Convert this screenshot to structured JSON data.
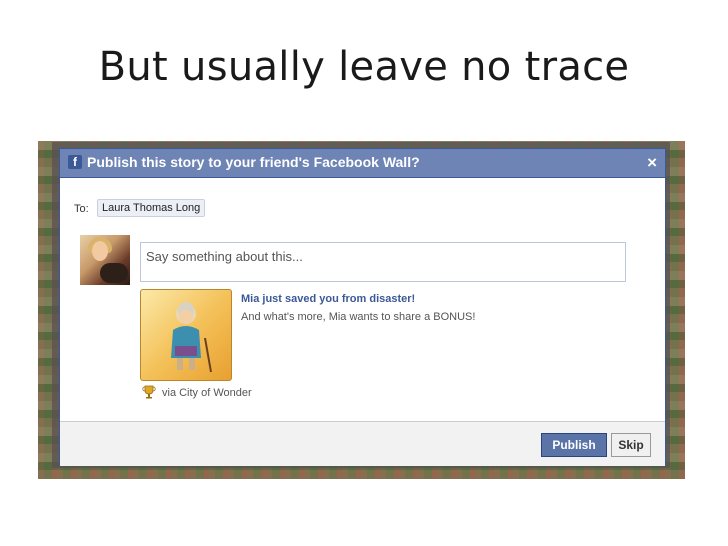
{
  "slide": {
    "title": "But usually leave no trace"
  },
  "dialog": {
    "title": "Publish this story to your friend's Facebook Wall?",
    "logo_letter": "f",
    "close_glyph": "×",
    "to_label": "To:",
    "recipient": "Laura Thomas Long",
    "comment_placeholder": "Say something about this...",
    "story": {
      "title": "Mia just saved you from disaster!",
      "description": "And what's more, Mia wants to share a BONUS!",
      "via": "via City of Wonder",
      "via_icon": "trophy-icon"
    },
    "buttons": {
      "publish": "Publish",
      "skip": "Skip"
    }
  },
  "colors": {
    "facebook_blue": "#3b5998",
    "header_blue": "#6d84b4",
    "publish_button": "#5b74a8"
  }
}
